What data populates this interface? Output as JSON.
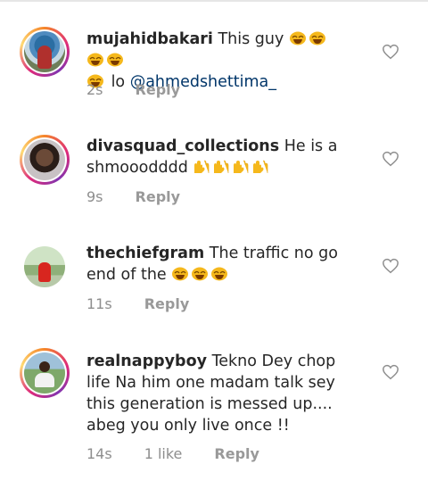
{
  "comments": [
    {
      "username": "mujahidbakari",
      "text_before": " This guy",
      "emoji_count_before": 4,
      "text_after": " lo ",
      "emoji_count_after_line_start": 1,
      "mention": "@ahmedshettima_",
      "time": "2s",
      "likes": "",
      "reply": "Reply"
    },
    {
      "username": "divasquad_collections",
      "text_before": " He is a shmooodddd",
      "emoji_count_before": 4,
      "time": "9s",
      "likes": "",
      "reply": "Reply"
    },
    {
      "username": "thechiefgram",
      "text_before": " The traffic no go end of the ",
      "emoji_count_before": 3,
      "time": "11s",
      "likes": "",
      "reply": "Reply"
    },
    {
      "username": "realnappyboy",
      "text_before": " Tekno Dey chop life Na him one madam talk sey this generation is messed up.... abeg you only live once !!",
      "emoji_count_before": 0,
      "time": "14s",
      "likes": "1 like",
      "reply": "Reply"
    }
  ],
  "colors": {
    "text": "#262626",
    "meta": "#8e8e8e",
    "mention": "#003569",
    "emoji": "#f5b81c"
  },
  "icons": {
    "like": "heart-outline-icon",
    "emoji_laugh": "laughing-emoji-icon",
    "emoji_raised": "raised-hands-emoji-icon"
  }
}
